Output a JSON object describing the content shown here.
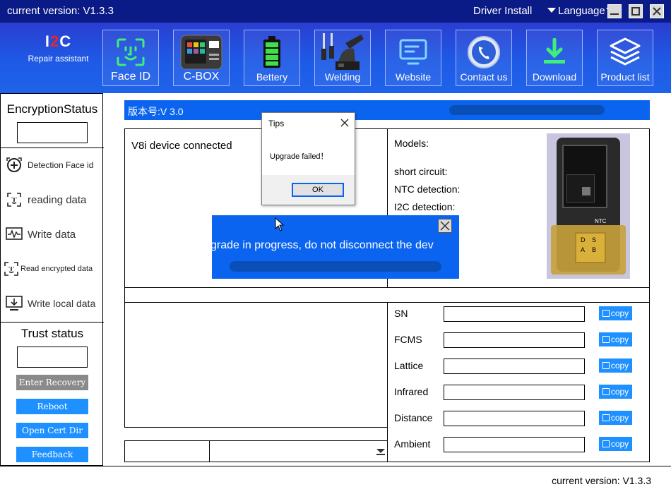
{
  "titlebar": {
    "version": "current version: V1.3.3",
    "driver_install": "Driver Install",
    "language": "Language"
  },
  "logo": {
    "mark_a": "I",
    "mark_b": "2",
    "mark_c": "C",
    "subtitle": "Repair assistant"
  },
  "toolbar": {
    "items": [
      {
        "label": "Face ID",
        "icon": "face-id-icon"
      },
      {
        "label": "C-BOX",
        "icon": "c-box-device-icon"
      },
      {
        "label": "Bettery",
        "icon": "battery-icon"
      },
      {
        "label": "Welding",
        "icon": "soldering-station-icon"
      },
      {
        "label": "Website",
        "icon": "website-monitor-icon"
      },
      {
        "label": "Contact us",
        "icon": "contact-phone-icon"
      },
      {
        "label": "Download",
        "icon": "download-icon"
      },
      {
        "label": "Product list",
        "icon": "layers-icon"
      }
    ]
  },
  "left": {
    "encryption_title": "EncryptionStatus",
    "menu": [
      {
        "label": "Detection Face id",
        "icon": "face-detect-icon"
      },
      {
        "label": "reading data",
        "icon": "face-scan-icon"
      },
      {
        "label": "Write data",
        "icon": "waveform-icon"
      },
      {
        "label": "Read encrypted data",
        "icon": "encrypted-scan-icon"
      },
      {
        "label": "Write local data",
        "icon": "monitor-download-icon"
      }
    ],
    "trust_title": "Trust status",
    "buttons": {
      "enter_recovery": "Enter Recovery",
      "reboot": "Reboot",
      "open_cert_dir": "Open Cert Dir",
      "feedback": "Feedback"
    }
  },
  "main": {
    "header_version": "版本号:V 3.0",
    "device_status": "V8i device connected",
    "models_label": "Models:",
    "short_circuit_label": "short circuit:",
    "ntc_label": "NTC detection:",
    "i2c_label": "I2C detection:",
    "chip_labels": {
      "ntc": "NTC",
      "d": "D",
      "s": "S",
      "a": "A",
      "b": "B"
    },
    "fields": [
      {
        "label": "SN",
        "value": "",
        "copy": "copy"
      },
      {
        "label": "FCMS",
        "value": "",
        "copy": "copy"
      },
      {
        "label": "Lattice",
        "value": "",
        "copy": "copy"
      },
      {
        "label": "Infrared",
        "value": "",
        "copy": "copy"
      },
      {
        "label": "Distance",
        "value": "",
        "copy": "copy"
      },
      {
        "label": "Ambient",
        "value": "",
        "copy": "copy"
      }
    ]
  },
  "upgrade_banner": {
    "message": "grade in progress, do not disconnect the dev"
  },
  "tips_dialog": {
    "title": "Tips",
    "message": "Upgrade failed！",
    "ok": "OK"
  },
  "statusbar": {
    "version": "current version: V1.3.3"
  },
  "colors": {
    "titlebar": "#0a1a86",
    "toolbar": "#1e5ae6",
    "accent_blue": "#0a64f0",
    "copy_button": "#1e90ff",
    "recovery_gray": "#8a8a8a"
  }
}
